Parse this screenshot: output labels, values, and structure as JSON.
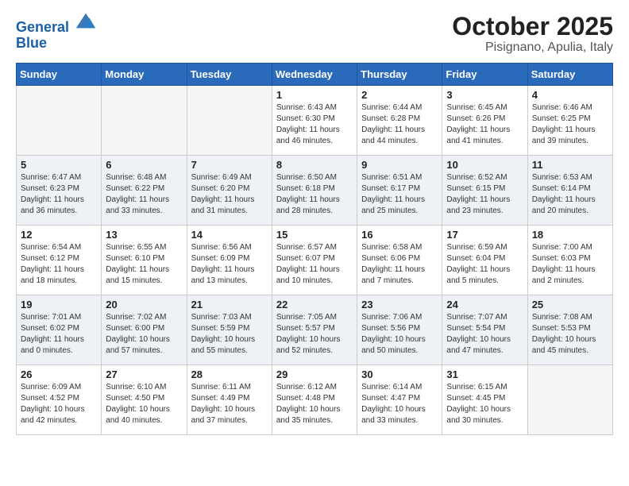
{
  "header": {
    "logo_line1": "General",
    "logo_line2": "Blue",
    "title": "October 2025",
    "subtitle": "Pisignano, Apulia, Italy"
  },
  "weekdays": [
    "Sunday",
    "Monday",
    "Tuesday",
    "Wednesday",
    "Thursday",
    "Friday",
    "Saturday"
  ],
  "weeks": [
    [
      {
        "day": "",
        "info": ""
      },
      {
        "day": "",
        "info": ""
      },
      {
        "day": "",
        "info": ""
      },
      {
        "day": "1",
        "info": "Sunrise: 6:43 AM\nSunset: 6:30 PM\nDaylight: 11 hours\nand 46 minutes."
      },
      {
        "day": "2",
        "info": "Sunrise: 6:44 AM\nSunset: 6:28 PM\nDaylight: 11 hours\nand 44 minutes."
      },
      {
        "day": "3",
        "info": "Sunrise: 6:45 AM\nSunset: 6:26 PM\nDaylight: 11 hours\nand 41 minutes."
      },
      {
        "day": "4",
        "info": "Sunrise: 6:46 AM\nSunset: 6:25 PM\nDaylight: 11 hours\nand 39 minutes."
      }
    ],
    [
      {
        "day": "5",
        "info": "Sunrise: 6:47 AM\nSunset: 6:23 PM\nDaylight: 11 hours\nand 36 minutes."
      },
      {
        "day": "6",
        "info": "Sunrise: 6:48 AM\nSunset: 6:22 PM\nDaylight: 11 hours\nand 33 minutes."
      },
      {
        "day": "7",
        "info": "Sunrise: 6:49 AM\nSunset: 6:20 PM\nDaylight: 11 hours\nand 31 minutes."
      },
      {
        "day": "8",
        "info": "Sunrise: 6:50 AM\nSunset: 6:18 PM\nDaylight: 11 hours\nand 28 minutes."
      },
      {
        "day": "9",
        "info": "Sunrise: 6:51 AM\nSunset: 6:17 PM\nDaylight: 11 hours\nand 25 minutes."
      },
      {
        "day": "10",
        "info": "Sunrise: 6:52 AM\nSunset: 6:15 PM\nDaylight: 11 hours\nand 23 minutes."
      },
      {
        "day": "11",
        "info": "Sunrise: 6:53 AM\nSunset: 6:14 PM\nDaylight: 11 hours\nand 20 minutes."
      }
    ],
    [
      {
        "day": "12",
        "info": "Sunrise: 6:54 AM\nSunset: 6:12 PM\nDaylight: 11 hours\nand 18 minutes."
      },
      {
        "day": "13",
        "info": "Sunrise: 6:55 AM\nSunset: 6:10 PM\nDaylight: 11 hours\nand 15 minutes."
      },
      {
        "day": "14",
        "info": "Sunrise: 6:56 AM\nSunset: 6:09 PM\nDaylight: 11 hours\nand 13 minutes."
      },
      {
        "day": "15",
        "info": "Sunrise: 6:57 AM\nSunset: 6:07 PM\nDaylight: 11 hours\nand 10 minutes."
      },
      {
        "day": "16",
        "info": "Sunrise: 6:58 AM\nSunset: 6:06 PM\nDaylight: 11 hours\nand 7 minutes."
      },
      {
        "day": "17",
        "info": "Sunrise: 6:59 AM\nSunset: 6:04 PM\nDaylight: 11 hours\nand 5 minutes."
      },
      {
        "day": "18",
        "info": "Sunrise: 7:00 AM\nSunset: 6:03 PM\nDaylight: 11 hours\nand 2 minutes."
      }
    ],
    [
      {
        "day": "19",
        "info": "Sunrise: 7:01 AM\nSunset: 6:02 PM\nDaylight: 11 hours\nand 0 minutes."
      },
      {
        "day": "20",
        "info": "Sunrise: 7:02 AM\nSunset: 6:00 PM\nDaylight: 10 hours\nand 57 minutes."
      },
      {
        "day": "21",
        "info": "Sunrise: 7:03 AM\nSunset: 5:59 PM\nDaylight: 10 hours\nand 55 minutes."
      },
      {
        "day": "22",
        "info": "Sunrise: 7:05 AM\nSunset: 5:57 PM\nDaylight: 10 hours\nand 52 minutes."
      },
      {
        "day": "23",
        "info": "Sunrise: 7:06 AM\nSunset: 5:56 PM\nDaylight: 10 hours\nand 50 minutes."
      },
      {
        "day": "24",
        "info": "Sunrise: 7:07 AM\nSunset: 5:54 PM\nDaylight: 10 hours\nand 47 minutes."
      },
      {
        "day": "25",
        "info": "Sunrise: 7:08 AM\nSunset: 5:53 PM\nDaylight: 10 hours\nand 45 minutes."
      }
    ],
    [
      {
        "day": "26",
        "info": "Sunrise: 6:09 AM\nSunset: 4:52 PM\nDaylight: 10 hours\nand 42 minutes."
      },
      {
        "day": "27",
        "info": "Sunrise: 6:10 AM\nSunset: 4:50 PM\nDaylight: 10 hours\nand 40 minutes."
      },
      {
        "day": "28",
        "info": "Sunrise: 6:11 AM\nSunset: 4:49 PM\nDaylight: 10 hours\nand 37 minutes."
      },
      {
        "day": "29",
        "info": "Sunrise: 6:12 AM\nSunset: 4:48 PM\nDaylight: 10 hours\nand 35 minutes."
      },
      {
        "day": "30",
        "info": "Sunrise: 6:14 AM\nSunset: 4:47 PM\nDaylight: 10 hours\nand 33 minutes."
      },
      {
        "day": "31",
        "info": "Sunrise: 6:15 AM\nSunset: 4:45 PM\nDaylight: 10 hours\nand 30 minutes."
      },
      {
        "day": "",
        "info": ""
      }
    ]
  ]
}
